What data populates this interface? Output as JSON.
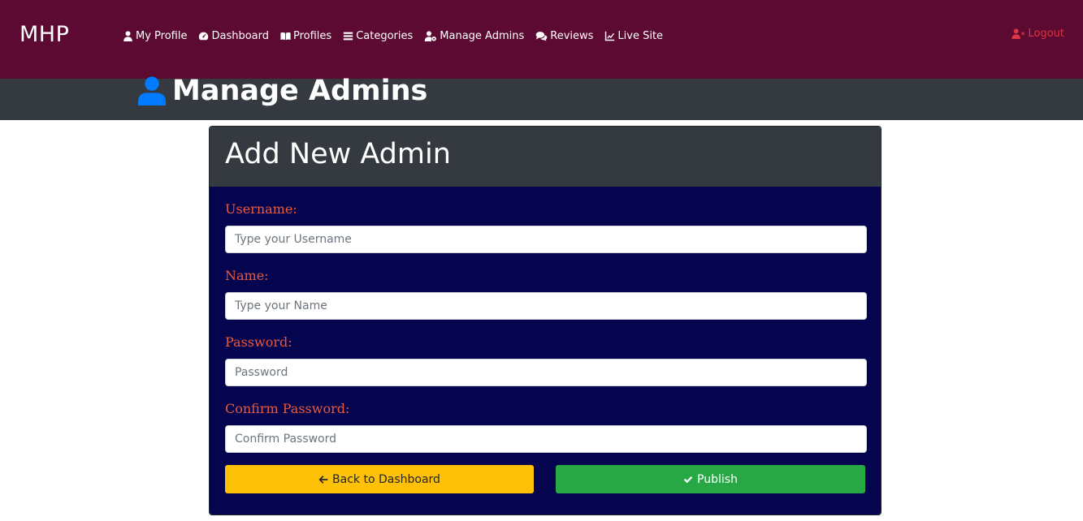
{
  "navbar": {
    "brand": "MHP",
    "links": [
      {
        "label": "My Profile",
        "icon": "user-icon"
      },
      {
        "label": "Dashboard",
        "icon": "tachometer-icon"
      },
      {
        "label": "Profiles",
        "icon": "book-open-icon"
      },
      {
        "label": "Categories",
        "icon": "list-icon"
      },
      {
        "label": "Manage Admins",
        "icon": "user-cog-icon"
      },
      {
        "label": "Reviews",
        "icon": "comments-icon"
      },
      {
        "label": "Live Site",
        "icon": "line-chart-icon"
      }
    ],
    "logout": {
      "label": "Logout",
      "icon": "user-times-icon"
    }
  },
  "page": {
    "title": "Manage Admins",
    "title_icon": "user-icon"
  },
  "form": {
    "header": "Add New Admin",
    "fields": {
      "username": {
        "label": "Username:",
        "placeholder": "Type your Username",
        "value": ""
      },
      "name": {
        "label": "Name:",
        "placeholder": "Type your Name",
        "value": ""
      },
      "password": {
        "label": "Password:",
        "placeholder": "Password",
        "value": ""
      },
      "confirm_password": {
        "label": "Confirm Password:",
        "placeholder": "Confirm Password",
        "value": ""
      }
    },
    "back_button": {
      "label": "Back to Dashboard",
      "icon": "arrow-left-icon"
    },
    "publish_button": {
      "label": "Publish",
      "icon": "check-icon"
    }
  },
  "colors": {
    "navbar_bg": "#5c0a31",
    "header_bg": "#343a40",
    "card_body_bg": "#05044f",
    "label_color": "#ea5a3c",
    "logout_color": "#dc3545",
    "title_icon_color": "#007bff",
    "warning": "#ffc107",
    "success": "#28a745"
  }
}
